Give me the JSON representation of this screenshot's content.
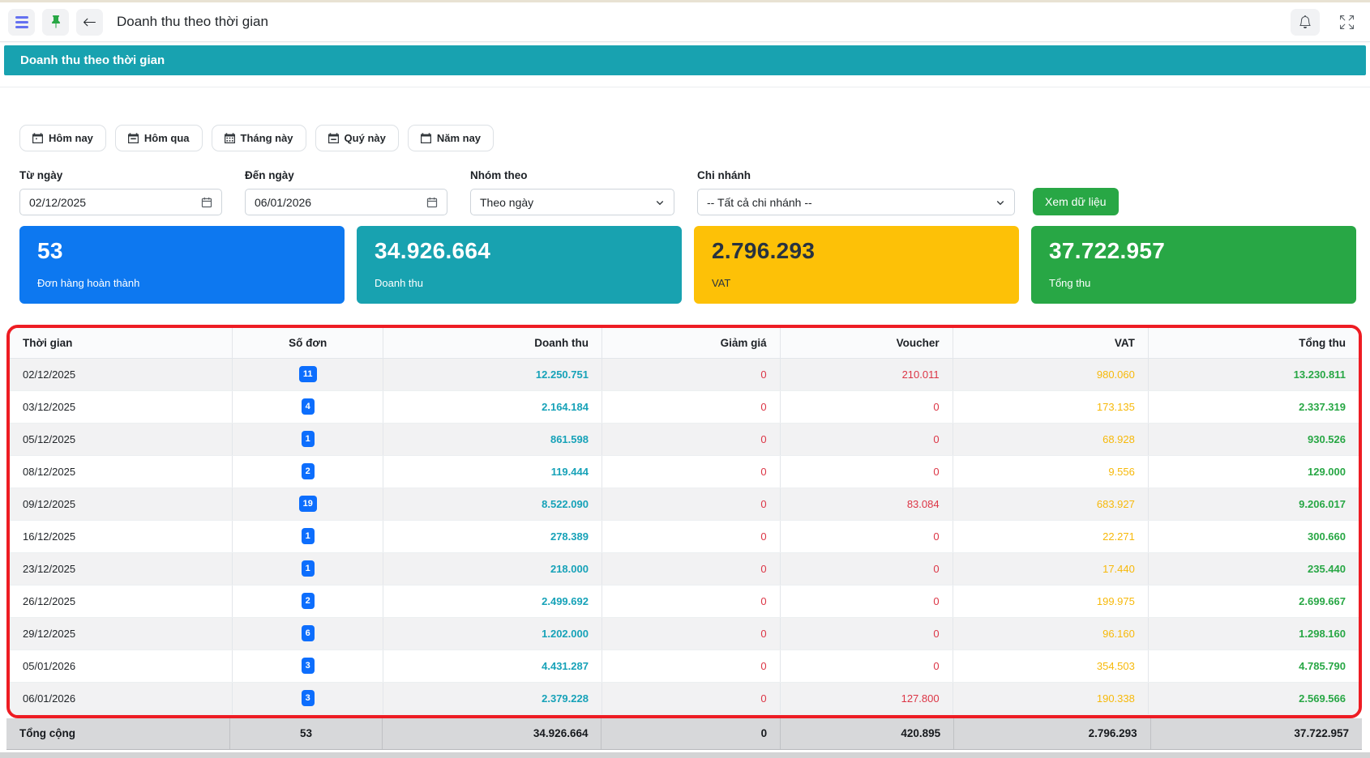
{
  "window": {
    "title": "Doanh thu theo thời gian",
    "icons": [
      "menu-icon",
      "pin-icon",
      "back-arrow-icon",
      "bell-icon",
      "expand-icon"
    ]
  },
  "banner": {
    "title": "Doanh thu theo thời gian"
  },
  "filters": {
    "quick_buttons": [
      {
        "label": "Hôm nay"
      },
      {
        "label": "Hôm qua"
      },
      {
        "label": "Tháng này"
      },
      {
        "label": "Quý này"
      },
      {
        "label": "Năm nay"
      }
    ],
    "from_date": {
      "label": "Từ ngày",
      "value": "02/12/2025"
    },
    "to_date": {
      "label": "Đến ngày",
      "value": "06/01/2026"
    },
    "group_by": {
      "label": "Nhóm theo",
      "value": "Theo ngày"
    },
    "branch": {
      "label": "Chi nhánh",
      "value": "-- Tất cả chi nhánh --"
    },
    "submit_label": "Xem dữ liệu"
  },
  "summary_cards": [
    {
      "value": "53",
      "label": "Đơn hàng hoàn thành",
      "color": "#0d78f0"
    },
    {
      "value": "34.926.664",
      "label": "Doanh thu",
      "color": "#18a2b0"
    },
    {
      "value": "2.796.293",
      "label": "VAT",
      "color": "#fdc107"
    },
    {
      "value": "37.722.957",
      "label": "Tổng thu",
      "color": "#28a745"
    }
  ],
  "table": {
    "columns": [
      "Thời gian",
      "Số đơn",
      "Doanh thu",
      "Giảm giá",
      "Voucher",
      "VAT",
      "Tổng thu"
    ],
    "rows": [
      {
        "date": "02/12/2025",
        "orders": "11",
        "revenue": "12.250.751",
        "discount": "0",
        "voucher": "210.011",
        "vat": "980.060",
        "total": "13.230.811"
      },
      {
        "date": "03/12/2025",
        "orders": "4",
        "revenue": "2.164.184",
        "discount": "0",
        "voucher": "0",
        "vat": "173.135",
        "total": "2.337.319"
      },
      {
        "date": "05/12/2025",
        "orders": "1",
        "revenue": "861.598",
        "discount": "0",
        "voucher": "0",
        "vat": "68.928",
        "total": "930.526"
      },
      {
        "date": "08/12/2025",
        "orders": "2",
        "revenue": "119.444",
        "discount": "0",
        "voucher": "0",
        "vat": "9.556",
        "total": "129.000"
      },
      {
        "date": "09/12/2025",
        "orders": "19",
        "revenue": "8.522.090",
        "discount": "0",
        "voucher": "83.084",
        "vat": "683.927",
        "total": "9.206.017"
      },
      {
        "date": "16/12/2025",
        "orders": "1",
        "revenue": "278.389",
        "discount": "0",
        "voucher": "0",
        "vat": "22.271",
        "total": "300.660"
      },
      {
        "date": "23/12/2025",
        "orders": "1",
        "revenue": "218.000",
        "discount": "0",
        "voucher": "0",
        "vat": "17.440",
        "total": "235.440"
      },
      {
        "date": "26/12/2025",
        "orders": "2",
        "revenue": "2.499.692",
        "discount": "0",
        "voucher": "0",
        "vat": "199.975",
        "total": "2.699.667"
      },
      {
        "date": "29/12/2025",
        "orders": "6",
        "revenue": "1.202.000",
        "discount": "0",
        "voucher": "0",
        "vat": "96.160",
        "total": "1.298.160"
      },
      {
        "date": "05/01/2026",
        "orders": "3",
        "revenue": "4.431.287",
        "discount": "0",
        "voucher": "0",
        "vat": "354.503",
        "total": "4.785.790"
      },
      {
        "date": "06/01/2026",
        "orders": "3",
        "revenue": "2.379.228",
        "discount": "0",
        "voucher": "127.800",
        "vat": "190.338",
        "total": "2.569.566"
      }
    ],
    "footer": {
      "label": "Tổng cộng",
      "orders": "53",
      "revenue": "34.926.664",
      "discount": "0",
      "voucher": "420.895",
      "vat": "2.796.293",
      "total": "37.722.957"
    }
  },
  "colors": {
    "banner_teal": "#18a2b0",
    "revenue_text": "#17a2b8",
    "discount_voucher_text": "#dc3545",
    "vat_text": "#f7b90a",
    "total_text": "#28a745",
    "badge_blue": "#0d6efd",
    "annotation_red": "#ee1c23",
    "submit_green": "#28a745"
  }
}
